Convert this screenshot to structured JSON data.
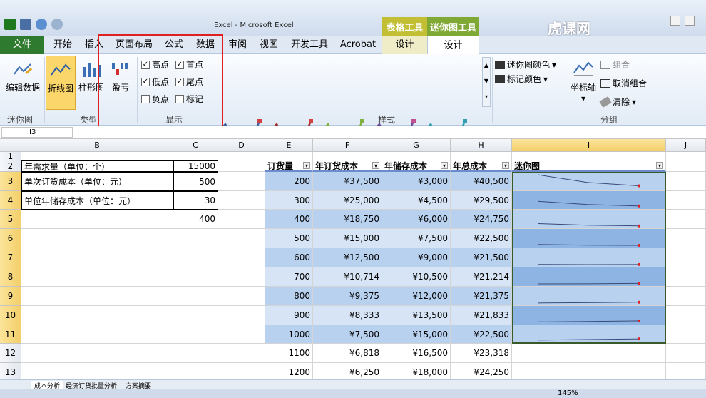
{
  "window": {
    "title": "Excel - Microsoft Excel",
    "watermark": "虎课网"
  },
  "context_groups": {
    "table_tools": "表格工具",
    "sparkline_tools": "迷你图工具"
  },
  "tabs": [
    "文件",
    "开始",
    "插入",
    "页面布局",
    "公式",
    "数据",
    "审阅",
    "视图",
    "开发工具",
    "Acrobat",
    "设计",
    "设计"
  ],
  "ribbon": {
    "edit_data": "编辑数据",
    "group_sparkline": "迷你图",
    "line": "折线图",
    "column": "柱形图",
    "winloss": "盈亏",
    "group_type": "类型",
    "show": {
      "high_point": "高点",
      "first_point": "首点",
      "low_point": "低点",
      "last_point": "尾点",
      "negative_point": "负点",
      "markers": "标记"
    },
    "group_show": "显示",
    "group_style": "样式",
    "sparkline_color": "迷你图颜色",
    "marker_color": "标记颜色",
    "axis": "坐标轴",
    "group": "组合",
    "ungroup": "取消组合",
    "clear": "清除",
    "group_group": "分组"
  },
  "namebox": "I3",
  "columns": [
    "B",
    "C",
    "D",
    "E",
    "F",
    "G",
    "H",
    "I",
    "J"
  ],
  "rows": [
    "1",
    "2",
    "3",
    "4",
    "5",
    "6",
    "7",
    "8",
    "9",
    "10",
    "11",
    "12",
    "13"
  ],
  "left_table": [
    {
      "label": "年需求量（单位：个）",
      "value": "15000"
    },
    {
      "label": "单次订货成本（单位：元）",
      "value": "500"
    },
    {
      "label": "单位年储存成本（单位：元）",
      "value": "30"
    },
    {
      "label": "",
      "value": "400"
    }
  ],
  "table_headers": [
    "订货量",
    "年订货成本",
    "年储存成本",
    "年总成本",
    "迷你图"
  ],
  "table_rows": [
    [
      "200",
      "¥37,500",
      "¥3,000",
      "¥40,500"
    ],
    [
      "300",
      "¥25,000",
      "¥4,500",
      "¥29,500"
    ],
    [
      "400",
      "¥18,750",
      "¥6,000",
      "¥24,750"
    ],
    [
      "500",
      "¥15,000",
      "¥7,500",
      "¥22,500"
    ],
    [
      "600",
      "¥12,500",
      "¥9,000",
      "¥21,500"
    ],
    [
      "700",
      "¥10,714",
      "¥10,500",
      "¥21,214"
    ],
    [
      "800",
      "¥9,375",
      "¥12,000",
      "¥21,375"
    ],
    [
      "900",
      "¥8,333",
      "¥13,500",
      "¥21,833"
    ],
    [
      "1000",
      "¥7,500",
      "¥15,000",
      "¥22,500"
    ],
    [
      "1100",
      "¥6,818",
      "¥16,500",
      "¥23,318"
    ],
    [
      "1200",
      "¥6,250",
      "¥18,000",
      "¥24,250"
    ]
  ],
  "sheet_tabs": [
    "成本分析",
    "经济订货批量分析",
    "方案摘要"
  ],
  "zoom": "145%",
  "colors": {
    "file_tab": "#2e7a2e",
    "band_dark": "#8db4e2",
    "band_light": "#b8d1ef",
    "marker": "#e02020",
    "highlight_box": "#e02020"
  }
}
